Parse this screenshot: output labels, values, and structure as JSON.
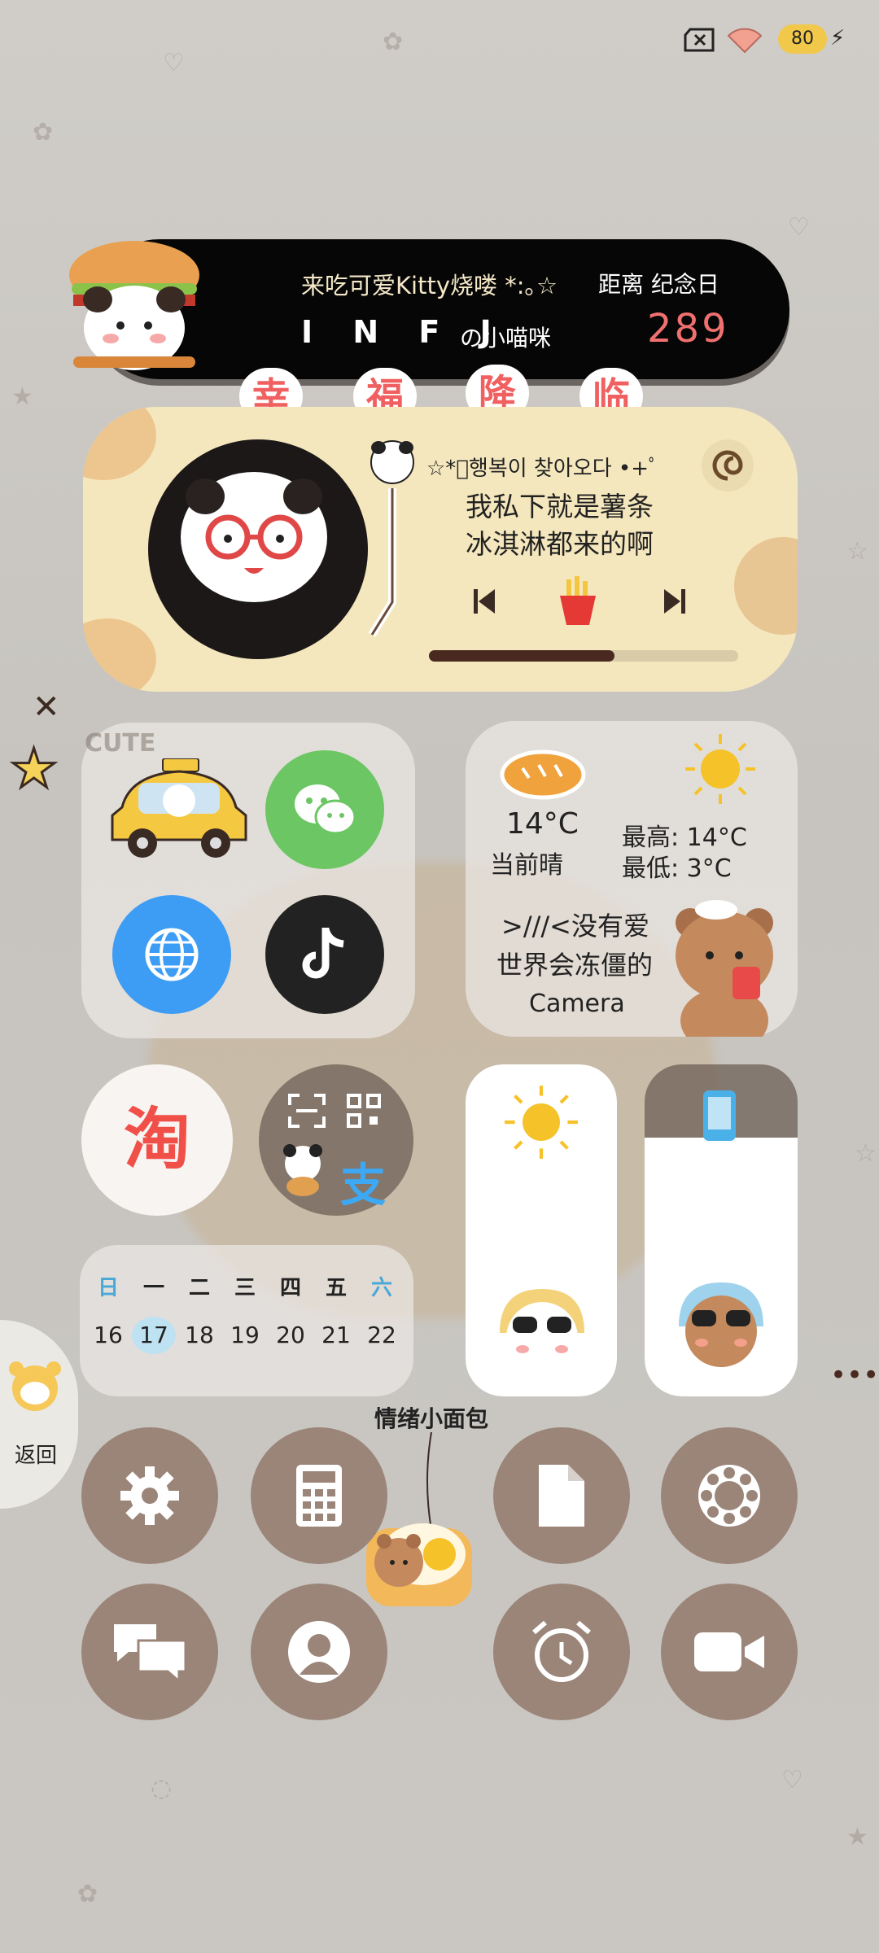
{
  "status_bar": {
    "battery": "80"
  },
  "banner": {
    "line1": "来吃可爱Kitty烧喽 *:｡☆",
    "line2": "I N F J",
    "line2_suffix": "の小喵咪",
    "distance_label": "距离  纪念日",
    "days": "289"
  },
  "tags": [
    "幸",
    "福",
    "降",
    "临"
  ],
  "music": {
    "korean": "☆*ﾟ행복이 찾아오다 •+ﾟ",
    "lyric1": "我私下就是薯条",
    "lyric2": "冰淇淋都来的啊",
    "progress": 0.6
  },
  "apps_card": {
    "cute_label": "CUTE"
  },
  "weather": {
    "current_temp": "14°C",
    "current_desc": "当前晴",
    "high": "最高:  14°C",
    "low": "最低:  3°C",
    "quote1": ">///<没有爱",
    "quote2": "世界会冻僵的",
    "camera": "Camera"
  },
  "taobao": {
    "label": "淘"
  },
  "alipay": {
    "label": "支"
  },
  "calendar": {
    "headers": [
      "日",
      "一",
      "二",
      "三",
      "四",
      "五",
      "六"
    ],
    "days": [
      "16",
      "17",
      "18",
      "19",
      "20",
      "21",
      "22"
    ],
    "today_index": 1
  },
  "sliders": {
    "brightness": 1.0,
    "volume": 0.78
  },
  "back_button": {
    "label": "返回"
  },
  "mood_bread": {
    "label": "情绪小面包"
  },
  "dock_row1": [
    "settings",
    "calculator",
    "files",
    "gallery"
  ],
  "dock_row2": [
    "messages",
    "contacts",
    "clock",
    "camera"
  ],
  "colors": {
    "banner": "#060606",
    "music_card": "#f5e7bd",
    "button": "#9b8579",
    "accent_red": "#f06060",
    "wechat": "#6cc664",
    "browser": "#3d9cf4"
  }
}
